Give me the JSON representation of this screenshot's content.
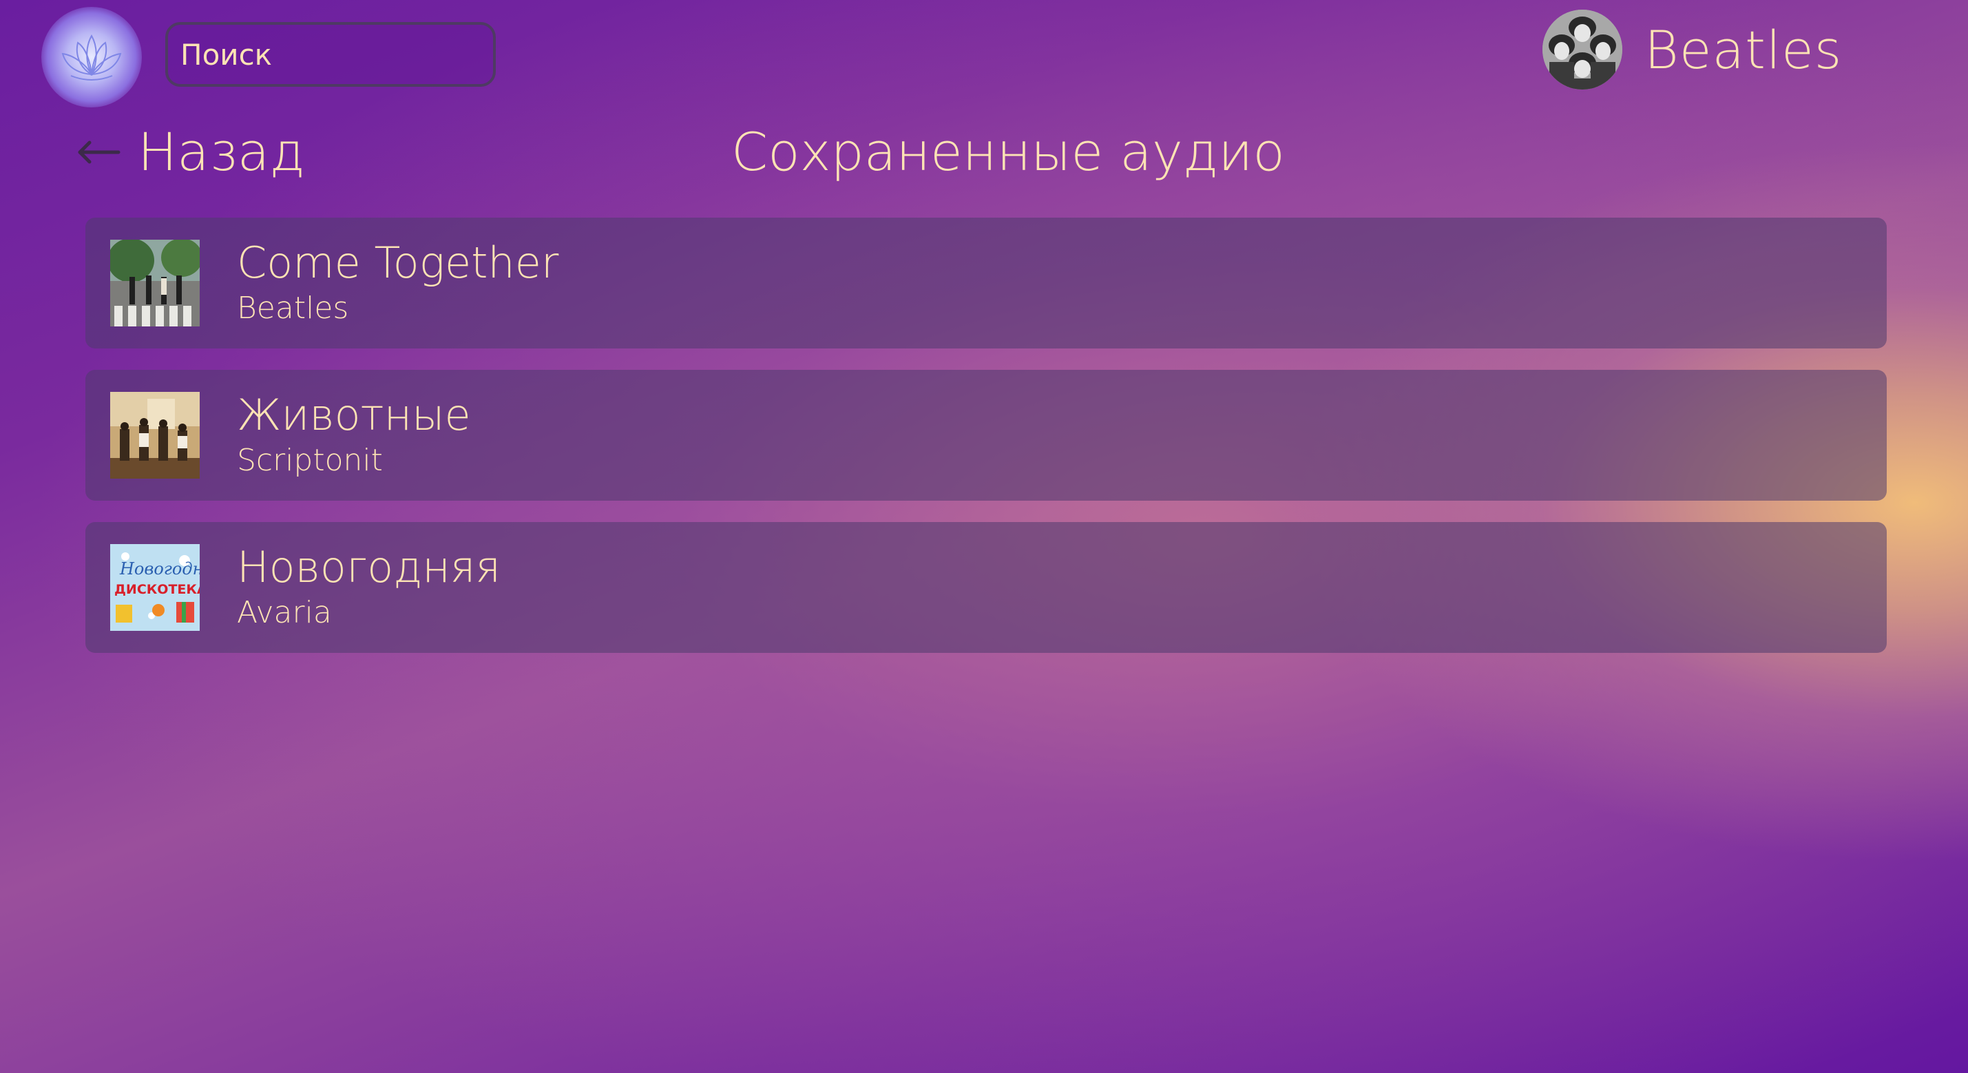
{
  "header": {
    "search": {
      "placeholder": "Поиск",
      "value": ""
    },
    "profile": {
      "name": "Beatles",
      "avatar_icon": "band-photo-avatar"
    }
  },
  "nav": {
    "back_label": "Назад",
    "back_icon": "arrow-left-icon",
    "page_title": "Сохраненные аудио"
  },
  "tracks": [
    {
      "title": "Come Together",
      "artist": "Beatles",
      "cover_icon": "abbey-road-cover"
    },
    {
      "title": "Животные",
      "artist": "Scriptonit",
      "cover_icon": "band-room-cover"
    },
    {
      "title": "Новогодняя",
      "artist": "Avaria",
      "cover_icon": "new-year-disco-cover",
      "cover_text": "Новогодняя ДИСКОТЕКА"
    }
  ],
  "colors": {
    "text": "#fde3b4",
    "background_top": "#6a1ea0",
    "background_glow": "#f0bc7a",
    "card": "#4e3a6e"
  }
}
